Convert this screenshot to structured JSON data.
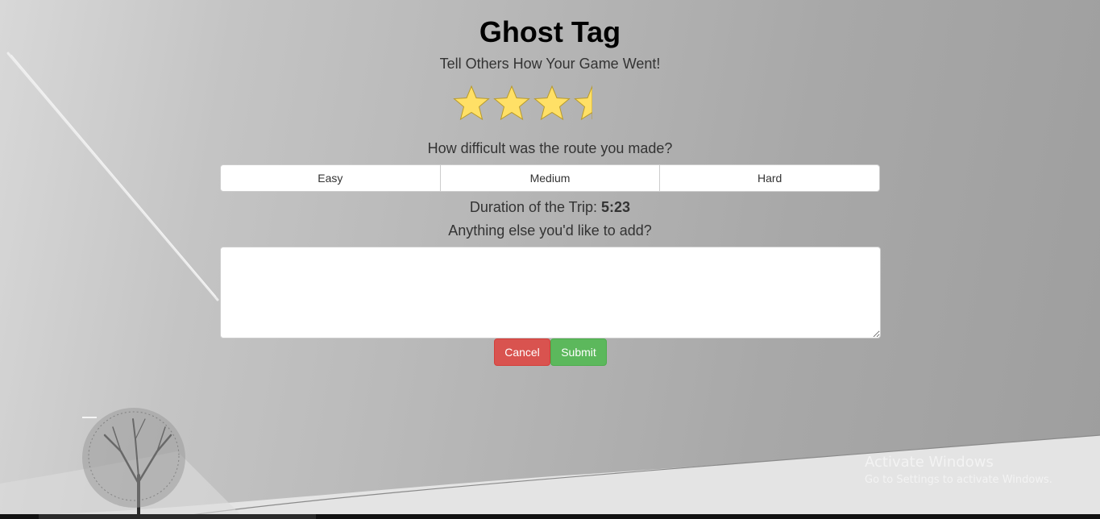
{
  "page": {
    "title": "Ghost Tag",
    "subtitle": "Tell Others How Your Game Went!"
  },
  "rating": {
    "value": 3.5,
    "max": 4,
    "star_color": "#ffe066"
  },
  "difficulty": {
    "question": "How difficult was the route you made?",
    "options": [
      "Easy",
      "Medium",
      "Hard"
    ]
  },
  "duration": {
    "label": "Duration of the Trip:",
    "value": "5:23"
  },
  "comment": {
    "question": "Anything else you'd like to add?",
    "value": ""
  },
  "actions": {
    "cancel_label": "Cancel",
    "submit_label": "Submit",
    "cancel_color": "#d9534f",
    "submit_color": "#5cb85c"
  },
  "watermark": {
    "title": "Activate Windows",
    "subtitle": "Go to Settings to activate Windows."
  }
}
